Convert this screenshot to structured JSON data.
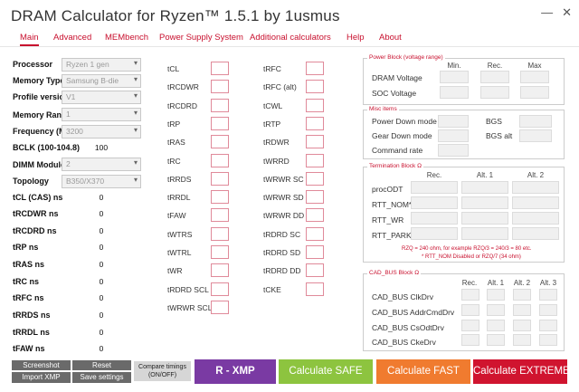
{
  "window": {
    "title": "DRAM Calculator for Ryzen™ 1.5.1 by 1usmus",
    "minimize": "—",
    "close": "✕"
  },
  "menu": [
    "Main",
    "Advanced",
    "MEMbench",
    "Power Supply System",
    "Additional calculators",
    "Help",
    "About"
  ],
  "left": {
    "processor": {
      "label": "Processor",
      "value": "Ryzen 1 gen"
    },
    "memory_type": {
      "label": "Memory Type",
      "value": "Samsung B-die"
    },
    "profile_version": {
      "label": "Profile version",
      "value": "V1"
    },
    "memory_rank": {
      "label": "Memory Rank",
      "value": "1"
    },
    "frequency": {
      "label": "Frequency (MT/s)",
      "value": "3200"
    },
    "bclk": {
      "label": "BCLK (100-104.8)",
      "value": "100"
    },
    "dimm_modules": {
      "label": "DIMM Modules",
      "value": "2"
    },
    "topology": {
      "label": "Topology",
      "value": "B350/X370"
    },
    "ns_rows": [
      {
        "label": "tCL (CAS) ns",
        "value": "0"
      },
      {
        "label": "tRCDWR ns",
        "value": "0"
      },
      {
        "label": "tRCDRD ns",
        "value": "0"
      },
      {
        "label": "tRP ns",
        "value": "0"
      },
      {
        "label": "tRAS ns",
        "value": "0"
      },
      {
        "label": "tRC ns",
        "value": "0"
      },
      {
        "label": "tRFC ns",
        "value": "0"
      },
      {
        "label": "tRRDS ns",
        "value": "0"
      },
      {
        "label": "tRRDL ns",
        "value": "0"
      },
      {
        "label": "tFAW ns",
        "value": "0"
      }
    ]
  },
  "timings_col1": [
    "tCL",
    "tRCDWR",
    "tRCDRD",
    "tRP",
    "tRAS",
    "tRC",
    "tRRDS",
    "tRRDL",
    "tFAW",
    "tWTRS",
    "tWTRL",
    "tWR",
    "tRDRD SCL",
    "tWRWR SCL"
  ],
  "timings_col2": [
    "tRFC",
    "tRFC (alt)",
    "tCWL",
    "tRTP",
    "tRDWR",
    "tWRRD",
    "tWRWR SC",
    "tWRWR SD",
    "tWRWR DD",
    "tRDRD SC",
    "tRDRD SD",
    "tRDRD DD",
    "tCKE"
  ],
  "voltage_block": {
    "title": "Power Block (voltage range)",
    "headers": [
      "Min.",
      "Rec.",
      "Max"
    ],
    "rows": [
      "DRAM Voltage",
      "SOC Voltage"
    ]
  },
  "misc_items": {
    "title": "Misc items",
    "left_rows": [
      "Power Down mode",
      "Gear Down mode",
      "Command rate"
    ],
    "right_rows": [
      "BGS",
      "BGS alt"
    ]
  },
  "termination_block": {
    "title": "Termination Block Ω",
    "headers": [
      "Rec.",
      "Alt. 1",
      "Alt. 2"
    ],
    "rows": [
      "procODT",
      "RTT_NOM*",
      "RTT_WR",
      "RTT_PARK"
    ],
    "note1": "RZQ = 240 ohm, for example RZQ/3 = 240/3 = 80 etc.",
    "note2": "* RTT_NOM Disabled or RZQ/7 (34 ohm)"
  },
  "cad_bus_block": {
    "title": "CAD_BUS Block Ω",
    "headers": [
      "Rec.",
      "Alt. 1",
      "Alt. 2",
      "Alt. 3"
    ],
    "rows": [
      "CAD_BUS ClkDrv",
      "CAD_BUS AddrCmdDrv",
      "CAD_BUS CsOdtDrv",
      "CAD_BUS CkeDrv"
    ]
  },
  "bottom": {
    "screenshot": "Screenshot",
    "reset": "Reset",
    "import_xmp": "Import XMP",
    "save_settings": "Save settings",
    "compare_line1": "Compare timings",
    "compare_line2": "(ON/OFF)",
    "rxmp": "R - XMP",
    "safe": "Calculate SAFE",
    "fast": "Calculate FAST",
    "extreme": "Calculate EXTREME"
  },
  "colors": {
    "accent": "#c8102e",
    "rxmp": "#7a3aa3",
    "safe": "#8dc43f",
    "fast": "#f07b2f",
    "extreme": "#d0142f"
  }
}
